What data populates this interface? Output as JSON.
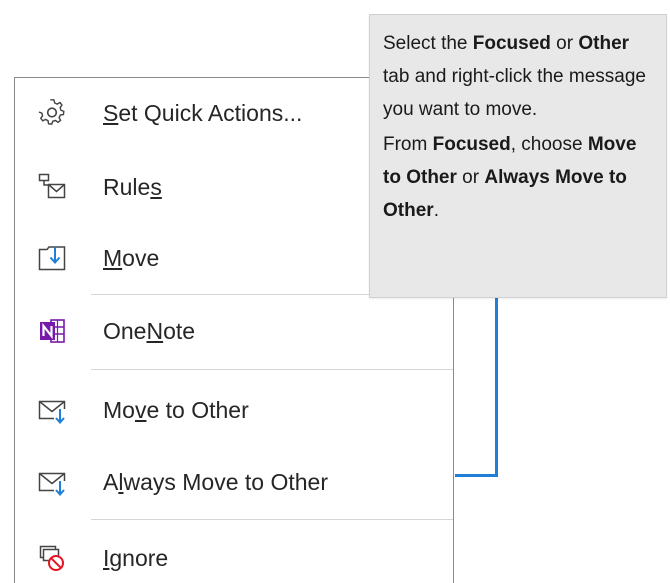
{
  "context_menu": {
    "items": [
      {
        "pre": "",
        "u": "S",
        "post": "et Quick Actions...",
        "icon": "gear-icon"
      },
      {
        "pre": "Rule",
        "u": "s",
        "post": "",
        "icon": "rules-icon"
      },
      {
        "pre": "",
        "u": "M",
        "post": "ove",
        "icon": "move-icon"
      },
      {
        "pre": "One",
        "u": "N",
        "post": "ote",
        "icon": "onenote-icon"
      },
      {
        "pre": "Mo",
        "u": "v",
        "post": "e to Other",
        "icon": "move-to-other-icon"
      },
      {
        "pre": "A",
        "u": "l",
        "post": "ways Move to Other",
        "icon": "always-move-to-other-icon"
      },
      {
        "pre": "",
        "u": "I",
        "post": "gnore",
        "icon": "ignore-icon"
      }
    ]
  },
  "callout": {
    "p1": {
      "t1": "Select the ",
      "b1": "Focused",
      "t2": " or ",
      "b2": "Other",
      "t3": " tab and right-click the message you want to move."
    },
    "p2": {
      "t1": "From ",
      "b1": "Focused",
      "t2": ", choose ",
      "b2": "Move to Other",
      "t3": " or ",
      "b3": "Always Move to Other",
      "t4": "."
    },
    "connector_color": "#1f7fd6"
  },
  "colors": {
    "onenote_purple": "#7719aa",
    "accent_blue": "#1f7fd6",
    "ignore_red": "#e81123"
  }
}
